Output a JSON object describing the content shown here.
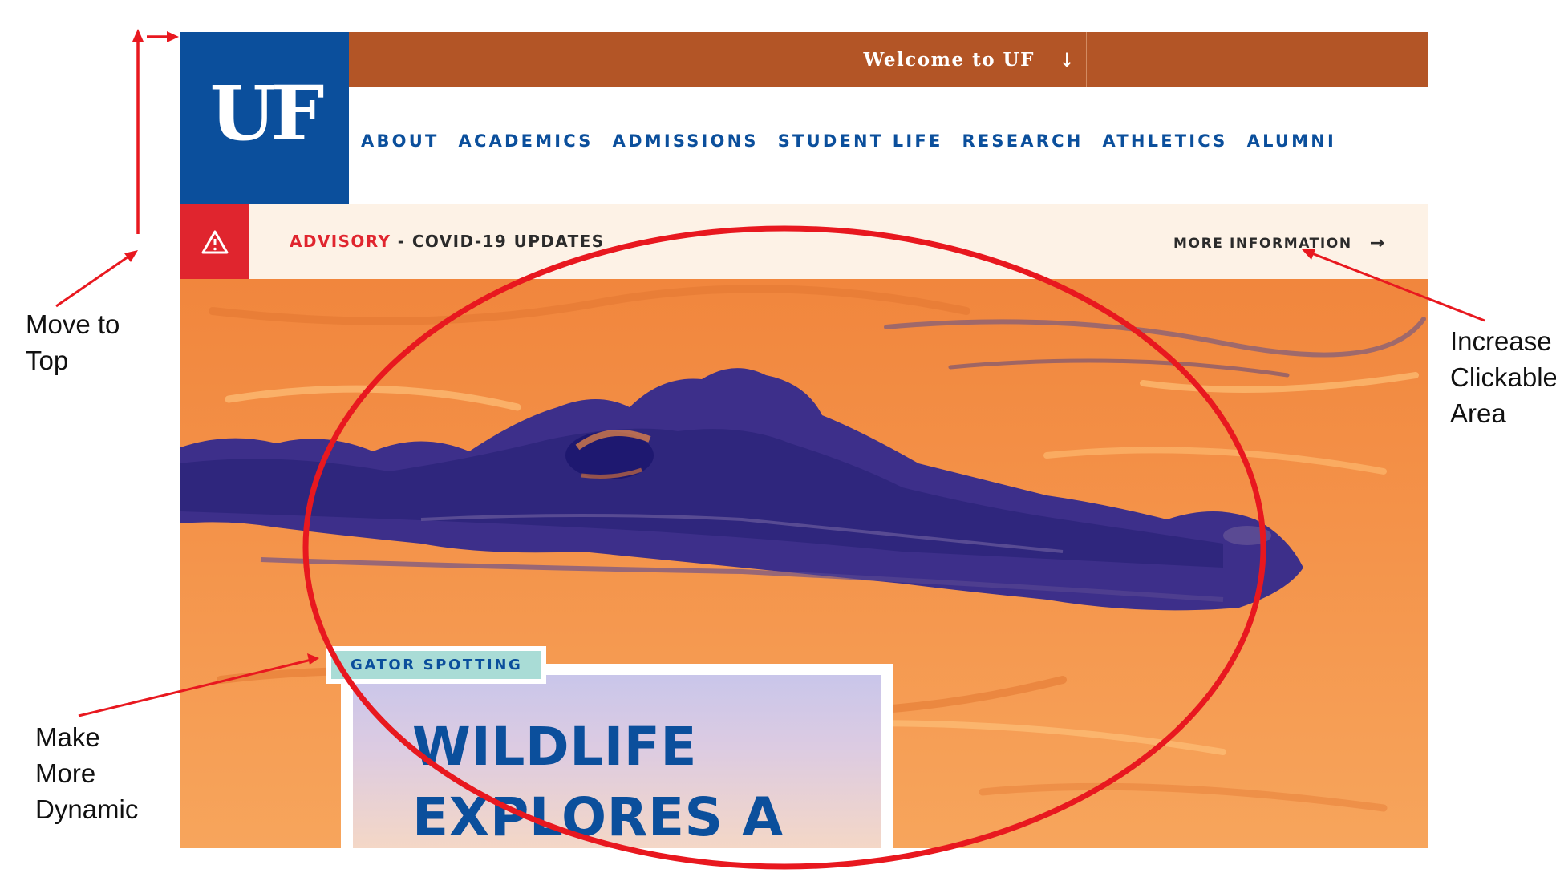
{
  "header": {
    "logo_text": "UF",
    "welcome_label": "Welcome to UF",
    "welcome_arrow": "↓",
    "search_icon": "search-icon",
    "menu_icon": "hamburger-menu-icon"
  },
  "nav": {
    "items": [
      {
        "label": "ABOUT"
      },
      {
        "label": "ACADEMICS"
      },
      {
        "label": "ADMISSIONS"
      },
      {
        "label": "STUDENT LIFE"
      },
      {
        "label": "RESEARCH"
      },
      {
        "label": "ATHLETICS"
      },
      {
        "label": "ALUMNI"
      }
    ]
  },
  "advisory": {
    "icon": "warning-triangle-icon",
    "label": "ADVISORY",
    "separator": " - ",
    "text": "COVID-19 UPDATES",
    "link_label": "MORE INFORMATION",
    "link_arrow": "→"
  },
  "hero": {
    "image": "alligator-in-water-duotone",
    "tag": "GATOR SPOTTING",
    "title_line1": "WILDLIFE",
    "title_line2": "EXPLORES A"
  },
  "annotations": {
    "move_to_top": [
      "Move to",
      "Top"
    ],
    "increase_clickable": [
      "Increase",
      "Clickable",
      "Area"
    ],
    "make_dynamic": [
      "Make",
      "More",
      "Dynamic"
    ]
  },
  "colors": {
    "uf_blue": "#0b4f9c",
    "uf_orange": "#b35526",
    "advisory_red": "#e0252e",
    "advisory_bg": "#fdf2e6",
    "tag_bg": "#a9dcd6",
    "annotation_red": "#e8181f"
  }
}
